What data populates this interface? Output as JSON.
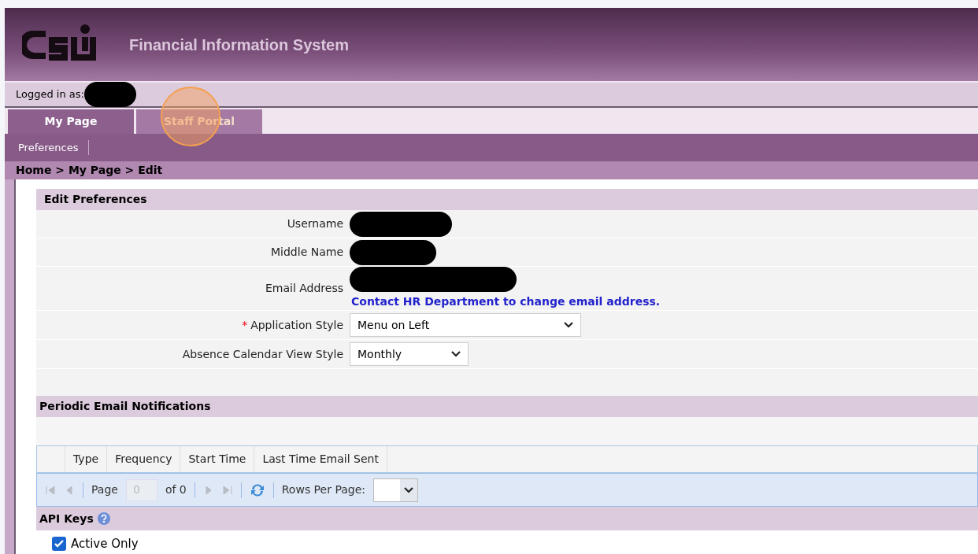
{
  "header": {
    "title": "Financial Information System"
  },
  "login": {
    "label": "Logged in as:"
  },
  "tabs": [
    {
      "label": "My Page",
      "selected": true
    },
    {
      "label": "Staff Portal",
      "selected": false
    }
  ],
  "nav": {
    "items": [
      "Preferences"
    ]
  },
  "breadcrumb": "Home > My Page > Edit",
  "edit_preferences": {
    "title": "Edit Preferences",
    "fields": [
      {
        "kind": "redacted",
        "label": "Username"
      },
      {
        "kind": "redacted",
        "label": "Middle Name"
      },
      {
        "kind": "redacted",
        "label": "Email Address",
        "note": "Contact HR Department to change email address."
      },
      {
        "kind": "select",
        "label": "Application Style",
        "marker": "*",
        "value": "Menu on Left"
      },
      {
        "kind": "select",
        "label": "Absence Calendar View Style",
        "value": "Monthly"
      }
    ]
  },
  "notifications": {
    "title": "Periodic Email Notifications",
    "columns": [
      "Type",
      "Frequency",
      "Start Time",
      "Last Time Email Sent"
    ],
    "pager": {
      "page_label": "Page",
      "page_value": "0",
      "of": "of 0",
      "rows_label": "Rows Per Page:"
    }
  },
  "api_keys": {
    "title": "API Keys",
    "active_only": {
      "label": "Active Only",
      "checked": true
    }
  }
}
